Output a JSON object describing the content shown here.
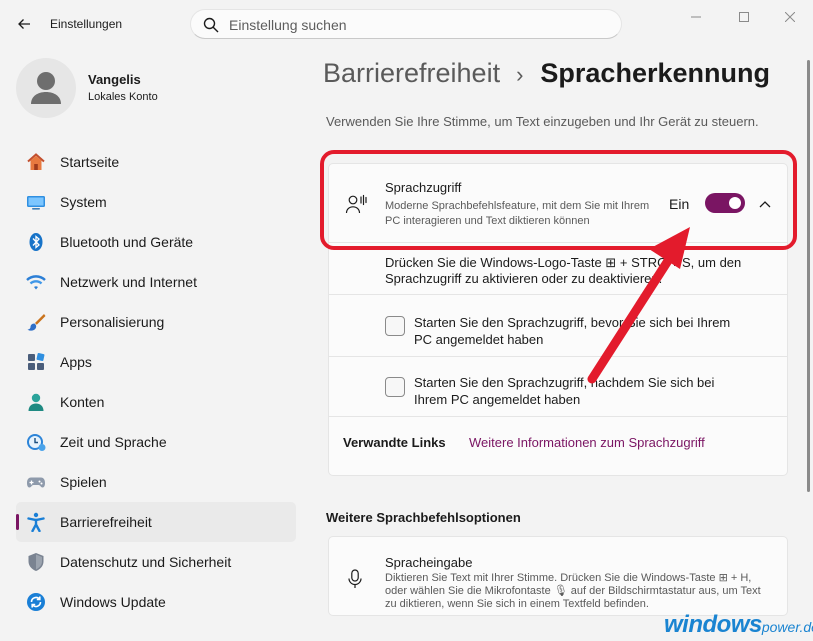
{
  "app": {
    "title": "Einstellungen",
    "search_placeholder": "Einstellung suchen"
  },
  "profile": {
    "name": "Vangelis",
    "account": "Lokales Konto"
  },
  "sidebar": {
    "active_index": 9,
    "items": [
      {
        "label": "Startseite",
        "icon": "home-icon"
      },
      {
        "label": "System",
        "icon": "system-icon"
      },
      {
        "label": "Bluetooth und Geräte",
        "icon": "bluetooth-icon"
      },
      {
        "label": "Netzwerk und Internet",
        "icon": "wifi-icon"
      },
      {
        "label": "Personalisierung",
        "icon": "brush-icon"
      },
      {
        "label": "Apps",
        "icon": "apps-icon"
      },
      {
        "label": "Konten",
        "icon": "account-icon"
      },
      {
        "label": "Zeit und Sprache",
        "icon": "time-language-icon"
      },
      {
        "label": "Spielen",
        "icon": "gamepad-icon"
      },
      {
        "label": "Barrierefreiheit",
        "icon": "accessibility-icon"
      },
      {
        "label": "Datenschutz und Sicherheit",
        "icon": "shield-icon"
      },
      {
        "label": "Windows Update",
        "icon": "update-icon"
      }
    ]
  },
  "main": {
    "breadcrumb_parent": "Barrierefreiheit",
    "breadcrumb_separator": "›",
    "breadcrumb_current": "Spracherkennung",
    "description": "Verwenden Sie Ihre Stimme, um Text einzugeben und Ihr Gerät zu steuern.",
    "voice_access": {
      "title": "Sprachzugriff",
      "description": "Moderne Sprachbefehlsfeature, mit dem Sie mit Ihrem PC interagieren und Text diktieren können",
      "state_label": "Ein",
      "enabled": true,
      "expanded": true,
      "shortcut_text": "Drücken Sie die Windows-Logo-Taste ⊞ + STRG + S, um den Sprachzugriff zu aktivieren oder zu deaktivieren.",
      "options": [
        {
          "label": "Starten Sie den Sprachzugriff, bevor Sie sich bei Ihrem PC angemeldet haben",
          "checked": false
        },
        {
          "label": "Starten Sie den Sprachzugriff, nachdem Sie sich bei Ihrem PC angemeldet haben",
          "checked": false
        }
      ],
      "related_label": "Verwandte Links",
      "related_link": "Weitere Informationen zum Sprachzugriff"
    },
    "more_section_title": "Weitere Sprachbefehlsoptionen",
    "voice_typing": {
      "title": "Spracheingabe",
      "description": "Diktieren Sie Text mit Ihrer Stimme. Drücken Sie die Windows-Taste ⊞ + H, oder wählen Sie die Mikrofontaste 🎙 auf der Bildschirmtastatur aus, um Text zu diktieren, wenn Sie sich in einem Textfeld befinden."
    }
  },
  "annotation": {
    "highlight_color": "#e31b2c"
  },
  "watermark": {
    "main": "windows",
    "sub": "power.de"
  },
  "colors": {
    "accent": "#7a1563",
    "background": "#f3f3f3",
    "card": "#fbfbfb"
  }
}
